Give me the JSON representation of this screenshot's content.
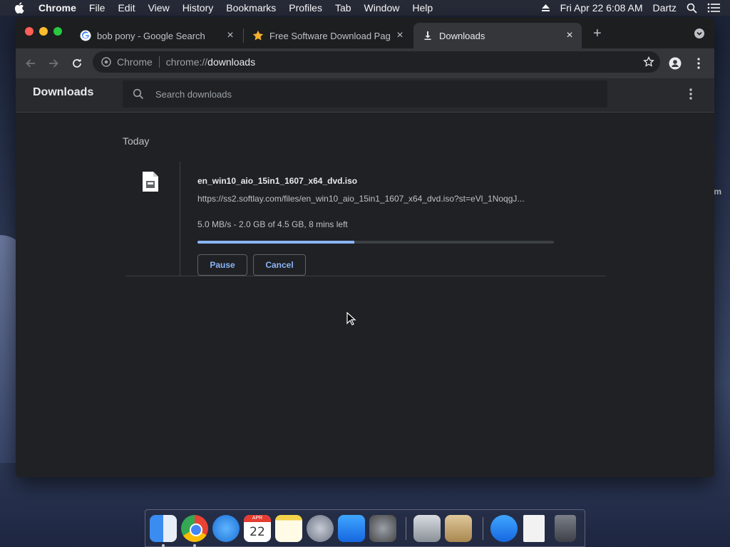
{
  "menubar": {
    "app_name": "Chrome",
    "items": [
      "File",
      "Edit",
      "View",
      "History",
      "Bookmarks",
      "Profiles",
      "Tab",
      "Window",
      "Help"
    ],
    "datetime": "Fri Apr 22  6:08 AM",
    "user": "Dartz",
    "icons": [
      "apple-icon",
      "eject-icon",
      "spotlight-search-icon",
      "notification-center-icon"
    ]
  },
  "tabs": [
    {
      "title": "bob pony - Google Search",
      "icon": "google-icon",
      "active": false
    },
    {
      "title": "Free Software Download Page",
      "icon": "star-icon",
      "active": false
    },
    {
      "title": "Downloads",
      "icon": "download-icon",
      "active": true
    }
  ],
  "omnibox": {
    "scheme": "Chrome",
    "url_prefix": "chrome://",
    "url_host": "downloads"
  },
  "downloads_page": {
    "title": "Downloads",
    "search_placeholder": "Search downloads",
    "date_group": "Today",
    "item": {
      "filename": "en_win10_aio_15in1_1607_x64_dvd.iso",
      "url": "https://ss2.softlay.com/files/en_win10_aio_15in1_1607_x64_dvd.iso?st=eVl_1NoqgJ...",
      "status": "5.0 MB/s - 2.0 GB of 4.5 GB, 8 mins left",
      "progress": 0.44,
      "pause_label": "Pause",
      "cancel_label": "Cancel"
    }
  },
  "desktop": {
    "partial_text": "m"
  },
  "dock": {
    "apps": [
      "Finder",
      "Google Chrome",
      "Safari",
      "Calendar",
      "Notes",
      "Launchpad",
      "App Store",
      "System Preferences",
      "Disk Utility",
      "Installer",
      "App Store Downloads",
      "Document",
      "Trash"
    ],
    "calendar_day": "22",
    "calendar_month": "APR"
  },
  "colors": {
    "accent": "#8ab4f8",
    "window_bg": "#202124",
    "toolbar_bg": "#35363a"
  }
}
